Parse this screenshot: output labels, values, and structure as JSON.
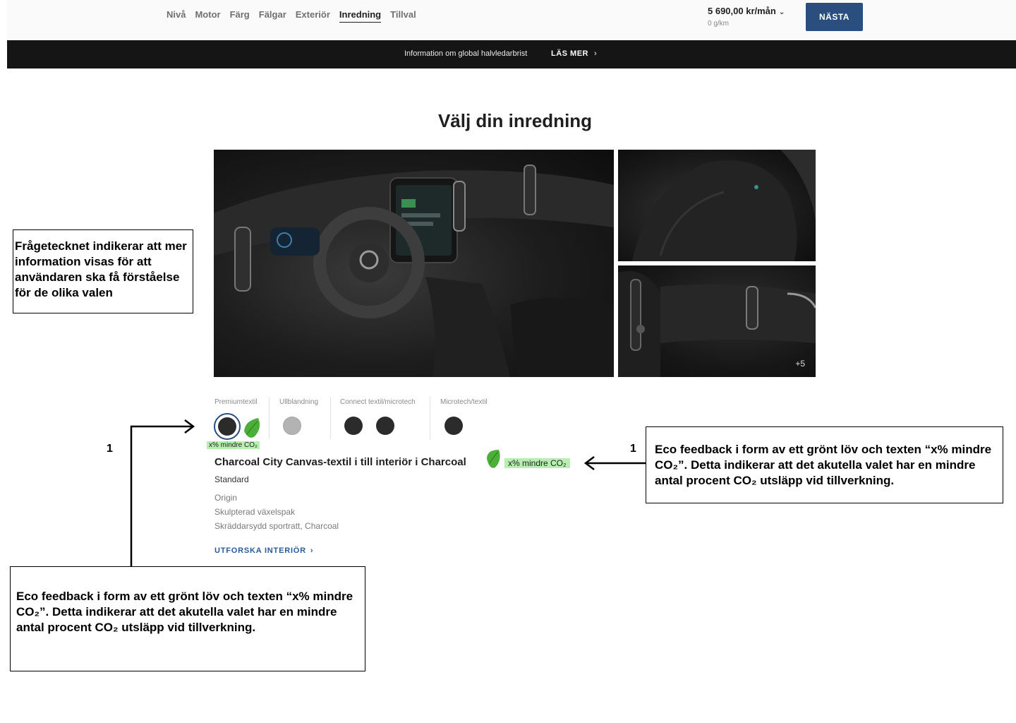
{
  "nav": {
    "items": [
      "Nivå",
      "Motor",
      "Färg",
      "Fälgar",
      "Exteriör",
      "Inredning",
      "Tillval"
    ],
    "active": "Inredning"
  },
  "summary": {
    "price": "5 690,00 kr/mån",
    "emission": "0 g/km",
    "next_label": "NÄSTA"
  },
  "banner": {
    "text": "Information om global halvledarbrist",
    "link": "LÄS MER"
  },
  "page_title": "Välj din inredning",
  "gallery": {
    "more_count": "+5"
  },
  "options": {
    "groups": [
      {
        "label": "Premiumtextil"
      },
      {
        "label": "Ullblandning"
      },
      {
        "label": "Connect textil/microtech"
      },
      {
        "label": "Microtech/textil"
      }
    ],
    "co2_tag_small": "x% mindre CO₂"
  },
  "selected": {
    "title": "Charcoal City Canvas-textil i till interiör i Charcoal",
    "co2_tag": "x% mindre CO₂",
    "level": "Standard",
    "features": [
      "Origin",
      "Skulpterad växelspak",
      "Skräddarsydd sportratt, Charcoal"
    ],
    "explore_label": "UTFORSKA INTERIÖR"
  },
  "annotations": {
    "question_note": "Frågetecknet indikerar att mer information visas för att användaren ska få förståelse för de olika valen",
    "eco_note": "Eco feedback i form av ett grönt löv och  texten  “x% mindre CO₂”. Detta indikerar att det akutella valet har en mindre antal procent CO₂ utsläpp vid tillverkning.",
    "eco_note_2": "Eco feedback i form av ett grönt löv och texten  “x% mindre CO₂”. Detta indikerar att det akutella valet har en mindre antal procent CO₂ utsläpp vid tillverkning.",
    "marker_left": "1",
    "marker_right": "1"
  },
  "colors": {
    "accent": "#2a4f7e",
    "eco_green": "#b6efb0",
    "leaf": "#4caf3a"
  }
}
